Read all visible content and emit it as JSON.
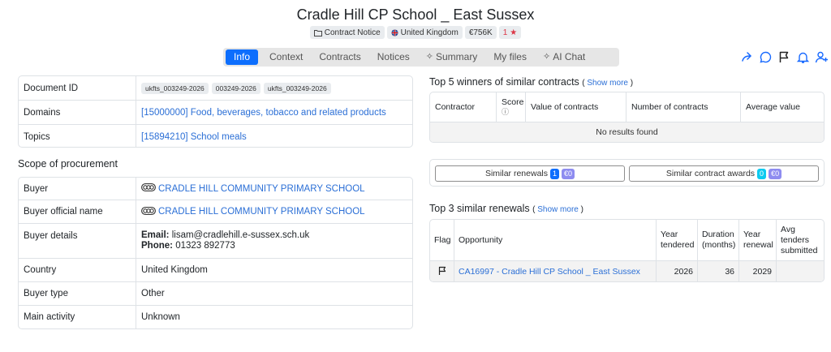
{
  "page": {
    "title": "Cradle Hill CP School _ East Sussex"
  },
  "badges": {
    "notice_type": "Contract Notice",
    "country": "United Kingdom",
    "value": "€756K",
    "rating_count": "1"
  },
  "tabs": [
    {
      "label": "Info",
      "active": true
    },
    {
      "label": "Context"
    },
    {
      "label": "Contracts"
    },
    {
      "label": "Notices"
    },
    {
      "label": "Summary",
      "icon": "sparkle-icon"
    },
    {
      "label": "My files"
    },
    {
      "label": "AI Chat",
      "icon": "sparkle-icon"
    }
  ],
  "actions": [
    "share-icon",
    "comment-icon",
    "flag-icon",
    "bell-icon",
    "add-user-icon"
  ],
  "info": {
    "document_id_label": "Document ID",
    "document_ids": [
      "ukfts_003249-2026",
      "003249-2026",
      "ukfts_003249-2026"
    ],
    "domains_label": "Domains",
    "domains_value": "[15000000] Food, beverages, tobacco and related products",
    "topics_label": "Topics",
    "topics_value": "[15894210] School meals"
  },
  "scope": {
    "title": "Scope of procurement",
    "buyer_label": "Buyer",
    "buyer_value": "CRADLE HILL COMMUNITY PRIMARY SCHOOL",
    "buyer_official_label": "Buyer official name",
    "buyer_official_value": "CRADLE HILL COMMUNITY PRIMARY SCHOOL",
    "buyer_details_label": "Buyer details",
    "email_label": "Email:",
    "email_value": "lisam@cradlehill.e-sussex.sch.uk",
    "phone_label": "Phone:",
    "phone_value": "01323 892773",
    "country_label": "Country",
    "country_value": "United Kingdom",
    "buyer_type_label": "Buyer type",
    "buyer_type_value": "Other",
    "main_activity_label": "Main activity",
    "main_activity_value": "Unknown"
  },
  "winners": {
    "title": "Top 5 winners of similar contracts",
    "show_more": "Show more",
    "columns": [
      "Contractor",
      "Score",
      "Value of contracts",
      "Number of contracts",
      "Average value"
    ],
    "empty": "No results found"
  },
  "similar_buttons": {
    "renewals_label": "Similar renewals",
    "renewals_count": "1",
    "renewals_value": "€0",
    "awards_label": "Similar contract awards",
    "awards_count": "0",
    "awards_value": "€0"
  },
  "renewals": {
    "title": "Top 3 similar renewals",
    "show_more": "Show more",
    "col_flag": "Flag",
    "col_opportunity": "Opportunity",
    "col_year_l1": "Year",
    "col_year_l2": "tendered",
    "col_duration_l1": "Duration",
    "col_duration_l2": "(months)",
    "col_renewal_l1": "Year",
    "col_renewal_l2": "renewal",
    "col_avg_l1": "Avg",
    "col_avg_l2": "tenders",
    "col_avg_l3": "submitted",
    "rows": [
      {
        "opportunity": "CA16997 - Cradle Hill CP School _ East Sussex",
        "year": "2026",
        "duration": "36",
        "renewal": "2029",
        "avg": ""
      }
    ]
  },
  "colors": {
    "accent": "#0d6efd",
    "link": "#2b6fd6",
    "star": "#dc3545"
  }
}
